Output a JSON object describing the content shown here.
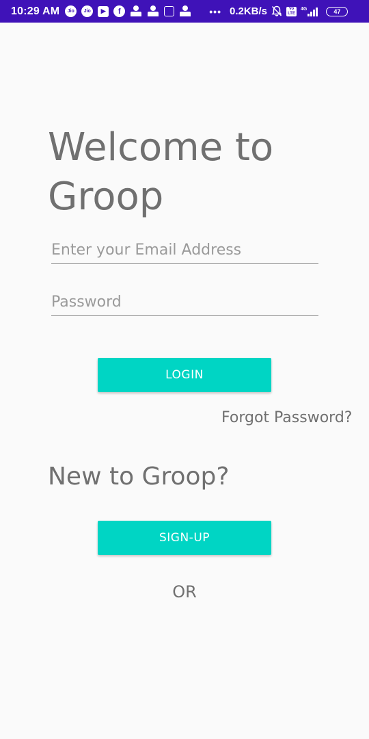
{
  "status_bar": {
    "time": "10:29 AM",
    "jio_label": "Jio",
    "dots": "•••",
    "net_speed": "0.2KB/s",
    "volte": "Vo LTE",
    "network_type": "4G",
    "battery": "47"
  },
  "login": {
    "title": "Welcome to Groop",
    "email_placeholder": "Enter your Email Address",
    "password_placeholder": "Password",
    "login_label": "LOGIN",
    "forgot_label": "Forgot Password?"
  },
  "signup": {
    "heading": "New to Groop?",
    "signup_label": "SIGN-UP",
    "or_label": "OR"
  },
  "colors": {
    "status_bar": "#3f12b8",
    "accent": "#00d5c4",
    "text": "#707070",
    "background": "#fafafa"
  }
}
